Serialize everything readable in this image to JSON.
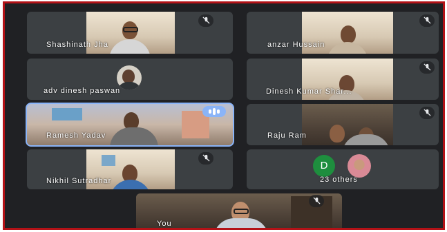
{
  "participants": [
    {
      "name": "Shashinath Jha"
    },
    {
      "name": "anzar Hussain"
    },
    {
      "name": "adv dinesh paswan"
    },
    {
      "name": "Dinesh Kumar Shar..."
    },
    {
      "name": "Ramesh Yadav"
    },
    {
      "name": "Raju Ram"
    },
    {
      "name": "Nikhil Sutradhar"
    }
  ],
  "others": {
    "letter": "D",
    "label": "23 others"
  },
  "self": {
    "name": "You"
  },
  "icons": {
    "mute": "mic-off-icon",
    "speaking": "audio-level-icon"
  },
  "colors": {
    "frame_border": "#b31217",
    "tile_bg": "#3c4043",
    "speaking_accent": "#8ab4f8",
    "avatar_green": "#1e8e3e"
  }
}
